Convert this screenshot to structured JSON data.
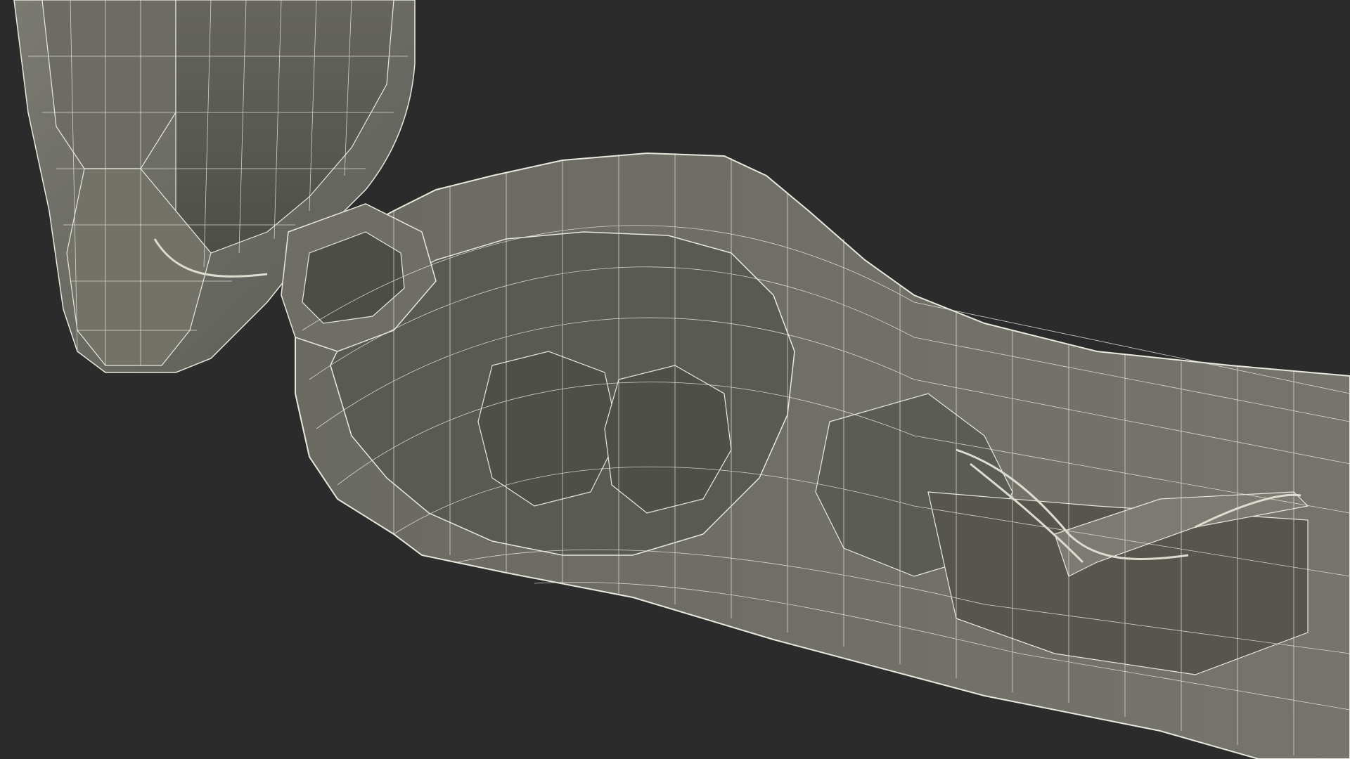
{
  "viewport": {
    "background": "#2b2b2b",
    "surface_fill": "#6f6f68",
    "surface_shadow": "#55554f",
    "surface_light": "#8a8a82",
    "wire_color": "#e8e8dc"
  },
  "model": {
    "render_mode": "wireframe-on-shaded"
  }
}
